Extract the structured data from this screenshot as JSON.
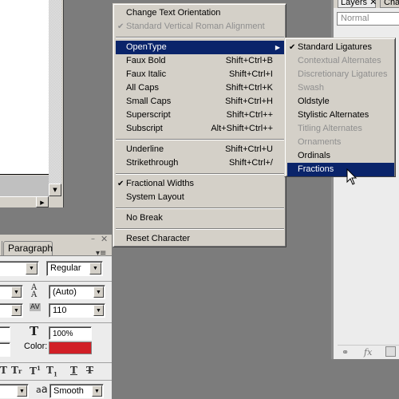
{
  "main_menu": {
    "items": [
      {
        "label": "Change Text Orientation",
        "shortcut": "",
        "enabled": true,
        "checked": false
      },
      {
        "label": "Standard Vertical Roman Alignment",
        "shortcut": "",
        "enabled": false,
        "checked": true
      },
      {
        "label": "OpenType",
        "shortcut": "",
        "enabled": true,
        "checked": false,
        "submenu": true,
        "highlighted": true
      },
      {
        "label": "Faux Bold",
        "shortcut": "Shift+Ctrl+B",
        "enabled": true,
        "checked": false
      },
      {
        "label": "Faux Italic",
        "shortcut": "Shift+Ctrl+I",
        "enabled": true,
        "checked": false
      },
      {
        "label": "All Caps",
        "shortcut": "Shift+Ctrl+K",
        "enabled": true,
        "checked": false
      },
      {
        "label": "Small Caps",
        "shortcut": "Shift+Ctrl+H",
        "enabled": true,
        "checked": false
      },
      {
        "label": "Superscript",
        "shortcut": "Shift+Ctrl++",
        "enabled": true,
        "checked": false
      },
      {
        "label": "Subscript",
        "shortcut": "Alt+Shift+Ctrl++",
        "enabled": true,
        "checked": false
      },
      {
        "label": "Underline",
        "shortcut": "Shift+Ctrl+U",
        "enabled": true,
        "checked": false
      },
      {
        "label": "Strikethrough",
        "shortcut": "Shift+Ctrl+/",
        "enabled": true,
        "checked": false
      },
      {
        "label": "Fractional Widths",
        "shortcut": "",
        "enabled": true,
        "checked": true
      },
      {
        "label": "System Layout",
        "shortcut": "",
        "enabled": true,
        "checked": false
      },
      {
        "label": "No Break",
        "shortcut": "",
        "enabled": true,
        "checked": false
      },
      {
        "label": "Reset Character",
        "shortcut": "",
        "enabled": true,
        "checked": false
      }
    ],
    "check_glyph": "✔",
    "submenu_arrow": "▶"
  },
  "opentype_submenu": {
    "items": [
      {
        "label": "Standard Ligatures",
        "enabled": true,
        "checked": true
      },
      {
        "label": "Contextual Alternates",
        "enabled": false,
        "checked": false
      },
      {
        "label": "Discretionary Ligatures",
        "enabled": false,
        "checked": false
      },
      {
        "label": "Swash",
        "enabled": false,
        "checked": false
      },
      {
        "label": "Oldstyle",
        "enabled": true,
        "checked": false
      },
      {
        "label": "Stylistic Alternates",
        "enabled": true,
        "checked": false
      },
      {
        "label": "Titling Alternates",
        "enabled": false,
        "checked": false
      },
      {
        "label": "Ornaments",
        "enabled": false,
        "checked": false
      },
      {
        "label": "Ordinals",
        "enabled": true,
        "checked": false
      },
      {
        "label": "Fractions",
        "enabled": true,
        "checked": false,
        "highlighted": true
      }
    ]
  },
  "character_panel": {
    "tab_paragraph": "Paragraph",
    "min_glyph": "–",
    "close_glyph": "✕",
    "menu_glyph": "▾≡",
    "font_style": "Regular",
    "leading": "(Auto)",
    "tracking": "110",
    "horizontal_scale": "100%",
    "color_label": "Color:",
    "text_color": "#d11f26",
    "antialias": "Smooth",
    "dropdown_glyph": "▼"
  },
  "layers_panel": {
    "tab_layers": "Layers ✕",
    "tab_channels": "Chann",
    "blend_mode": "Normal",
    "footer_icons": [
      "link-icon",
      "fx-icon",
      "mask-icon"
    ]
  },
  "document": {
    "scroll_down_glyph": "▼",
    "scroll_right_glyph": "▶"
  },
  "colors": {
    "menu_highlight": "#0a246a",
    "menu_bg": "#d4d0c8",
    "disabled_text": "#8f8f8f",
    "workspace_bg": "#7c7c7c"
  }
}
